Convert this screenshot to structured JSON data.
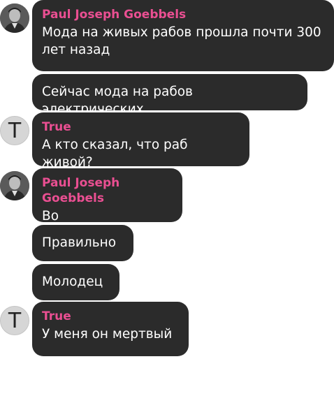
{
  "chat": {
    "accent_color": "#ea4f92",
    "bubble_color": "#2b2b2b",
    "messages": [
      {
        "sender": "Paul Joseph Goebbels",
        "avatar": "photo",
        "text": "Мода на живых рабов прошла почти 300 лет назад"
      },
      {
        "text": "Сейчас мода на рабов электрических"
      },
      {
        "sender": "True",
        "avatar": "T",
        "text": "А кто сказал, что раб живой?"
      },
      {
        "sender": "Paul Joseph Goebbels",
        "avatar": "photo",
        "text": "Во"
      },
      {
        "text": "Правильно"
      },
      {
        "text": "Молодец"
      },
      {
        "sender": "True",
        "avatar": "T",
        "text": "У меня он мертвый"
      }
    ]
  }
}
